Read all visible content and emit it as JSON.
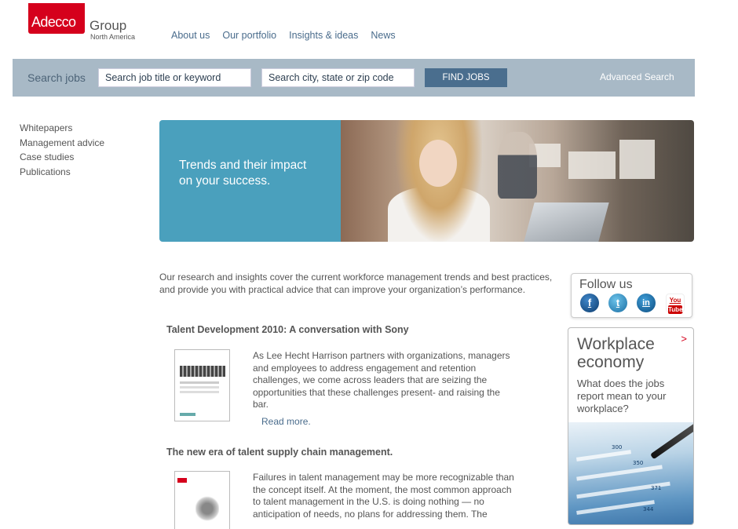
{
  "logo": {
    "brand": "Adecco",
    "group": "Group",
    "region": "North America"
  },
  "topnav": {
    "items": [
      "About us",
      "Our portfolio",
      "Insights & ideas",
      "News"
    ]
  },
  "search": {
    "label": "Search jobs",
    "keyword_placeholder": "Search job title or keyword",
    "location_placeholder": "Search city, state or zip code",
    "button": "FIND JOBS",
    "advanced": "Advanced Search"
  },
  "leftnav": {
    "items": [
      "Whitepapers",
      "Management advice",
      "Case studies",
      "Publications"
    ]
  },
  "hero": {
    "line1": "Trends and their impact",
    "line2": "on your success."
  },
  "intro": "Our research and insights cover the current workforce management trends and best practices, and provide you with practical advice that can improve your organization’s performance.",
  "articles": [
    {
      "title": "Talent Development 2010: A conversation with Sony",
      "body": "As Lee Hecht Harrison partners with organizations, managers and employees to address engagement and retention challenges, we come across leaders that are seizing the opportunities that these challenges present- and raising the bar.",
      "readmore": "Read more."
    },
    {
      "title": "The new era of talent supply chain management.",
      "body_line1": "Failures in talent management may be more recognizable than the concept itself. At the moment, the most common approach",
      "body_line2": "to talent management in the U.S. is doing nothing — no anticipation of needs, no plans for addressing them. The"
    }
  ],
  "follow": {
    "title": "Follow us",
    "icons": [
      "facebook-icon",
      "twitter-icon",
      "linkedin-icon",
      "youtube-icon"
    ],
    "fb_glyph": "f",
    "tw_glyph": "t",
    "li_glyph": "in",
    "yt_you": "You",
    "yt_tube": "Tube"
  },
  "ad": {
    "title": "Workplace economy",
    "chevron": ">",
    "text": "What does the jobs report mean to your workplace?",
    "numbers": [
      "300",
      "350",
      "371",
      "344"
    ]
  },
  "colors": {
    "brand_red": "#d5001c",
    "search_bar": "#a8b9c6",
    "button": "#4a6e8e",
    "hero_blue": "#4aa0bd",
    "link": "#4a6c8c"
  }
}
